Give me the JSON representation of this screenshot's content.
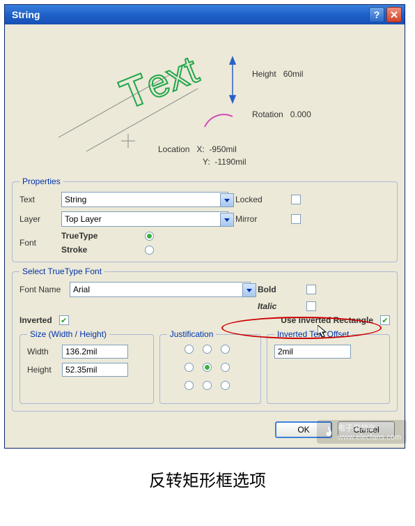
{
  "window": {
    "title": "String"
  },
  "preview": {
    "sample_text": "Text",
    "height_label": "Height",
    "height_value": "60mil",
    "rotation_label": "Rotation",
    "rotation_value": "0.000",
    "location_label": "Location",
    "location_x_label": "X:",
    "location_x_value": "-950mil",
    "location_y_label": "Y:",
    "location_y_value": "-1190mil"
  },
  "properties": {
    "legend": "Properties",
    "text_label": "Text",
    "text_value": "String",
    "layer_label": "Layer",
    "layer_value": "Top Layer",
    "font_label": "Font",
    "truetype_label": "TrueType",
    "stroke_label": "Stroke",
    "locked_label": "Locked",
    "mirror_label": "Mirror",
    "font_selected": "truetype"
  },
  "truetype": {
    "legend": "Select TrueType Font",
    "fontname_label": "Font Name",
    "fontname_value": "Arial",
    "bold_label": "Bold",
    "italic_label": "Italic",
    "inverted_label": "Inverted",
    "inverted_checked": true,
    "use_inv_rect_label": "Use Inverted Rectangle",
    "use_inv_rect_checked": true,
    "size": {
      "legend": "Size (Width / Height)",
      "width_label": "Width",
      "width_value": "136.2mil",
      "height_label": "Height",
      "height_value": "52.35mil"
    },
    "justification": {
      "legend": "Justification",
      "selected": 4
    },
    "offset": {
      "legend": "Inverted Text Offset",
      "value": "2mil"
    }
  },
  "buttons": {
    "ok": "OK",
    "cancel": "Cancel"
  },
  "caption": "反转矩形框选项",
  "watermark": {
    "brand": "电子发烧友",
    "url": "www.elecfans.com"
  }
}
